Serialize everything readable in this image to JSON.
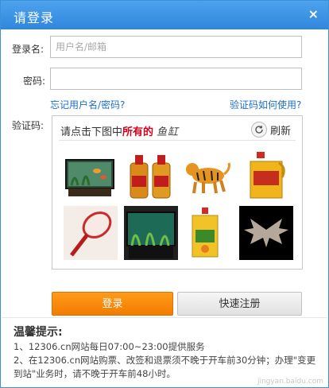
{
  "dialog": {
    "title": "请登录",
    "close_glyph": "×"
  },
  "form": {
    "username_label": "登录名:",
    "username_placeholder": "用户名/邮箱",
    "username_value": "",
    "password_label": "密码:",
    "password_value": "",
    "forgot_link": "忘记用户名/密码?",
    "captcha_help_link": "验证码如何使用?",
    "captcha_label": "验证码:"
  },
  "captcha": {
    "prompt_prefix": "请点击下图中",
    "prompt_emphasis": "所有的",
    "target_word": "鱼缸",
    "refresh_label": "刷新",
    "images": [
      {
        "name": "fish-tank-image",
        "subject": "fish tank"
      },
      {
        "name": "oil-bottles-image",
        "subject": "oil bottles"
      },
      {
        "name": "tiger-image",
        "subject": "tiger"
      },
      {
        "name": "oil-jug-image",
        "subject": "oil jug"
      },
      {
        "name": "tennis-racket-image",
        "subject": "racket"
      },
      {
        "name": "aquarium-image",
        "subject": "aquarium"
      },
      {
        "name": "oil-can-image",
        "subject": "oil can"
      },
      {
        "name": "bat-image",
        "subject": "bat"
      }
    ]
  },
  "buttons": {
    "login": "登录",
    "register": "快速注册"
  },
  "tips": {
    "title": "温馨提示:",
    "line1": "1、12306.cn网站每日07:00~23:00提供服务",
    "line2a": "2、在12306.cn网站购票、改签和退票须不晚于开车前30分钟；办理\"变更",
    "line2b": "到站\"业务时，请不晚于开车前48小时。"
  },
  "watermark": "jingyan.baidu.com",
  "colors": {
    "title_bar": "#2f87dd",
    "link": "#1d6ec7",
    "login_button": "#f27c00",
    "emphasis": "#d9001b"
  }
}
